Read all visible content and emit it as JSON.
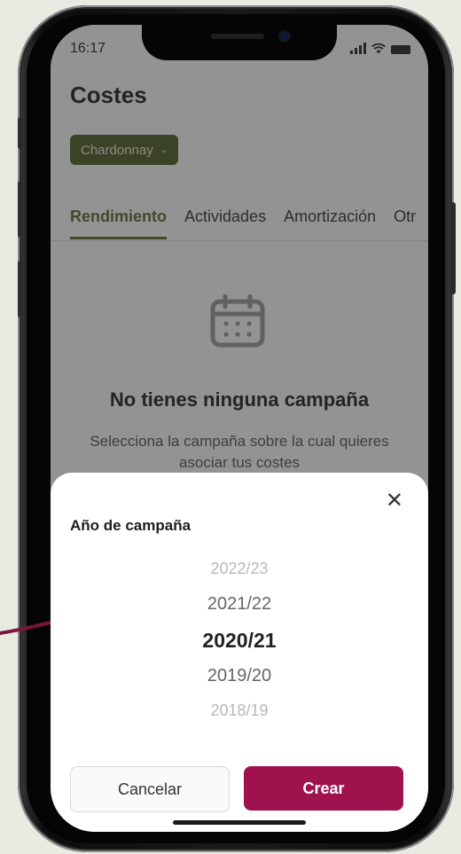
{
  "status_bar": {
    "time": "16:17"
  },
  "page": {
    "title": "Costes"
  },
  "filter": {
    "label": "Chardonnay",
    "arrow": "⌄"
  },
  "tabs": [
    {
      "label": "Rendimiento"
    },
    {
      "label": "Actividades"
    },
    {
      "label": "Amortización"
    },
    {
      "label": "Otr"
    }
  ],
  "empty_state": {
    "title": "No tienes ninguna campaña",
    "description": "Selecciona la campaña sobre la cual quieres asociar tus costes"
  },
  "sheet": {
    "close": "✕",
    "title": "Año de campaña",
    "options": [
      "2022/23",
      "2021/22",
      "2020/21",
      "2019/20",
      "2018/19"
    ],
    "selected": "2020/21",
    "cancel": "Cancelar",
    "create": "Crear"
  },
  "colors": {
    "accent": "#5c6d2b",
    "chip": "#4c5e24",
    "primary": "#a0124e",
    "arrow": "#7d1440",
    "background": "#e9ebe3"
  },
  "icons": {
    "calendar": "calendar-icon",
    "close": "close-icon",
    "signal": "signal-icon",
    "wifi": "wifi-icon",
    "battery": "battery-icon"
  }
}
